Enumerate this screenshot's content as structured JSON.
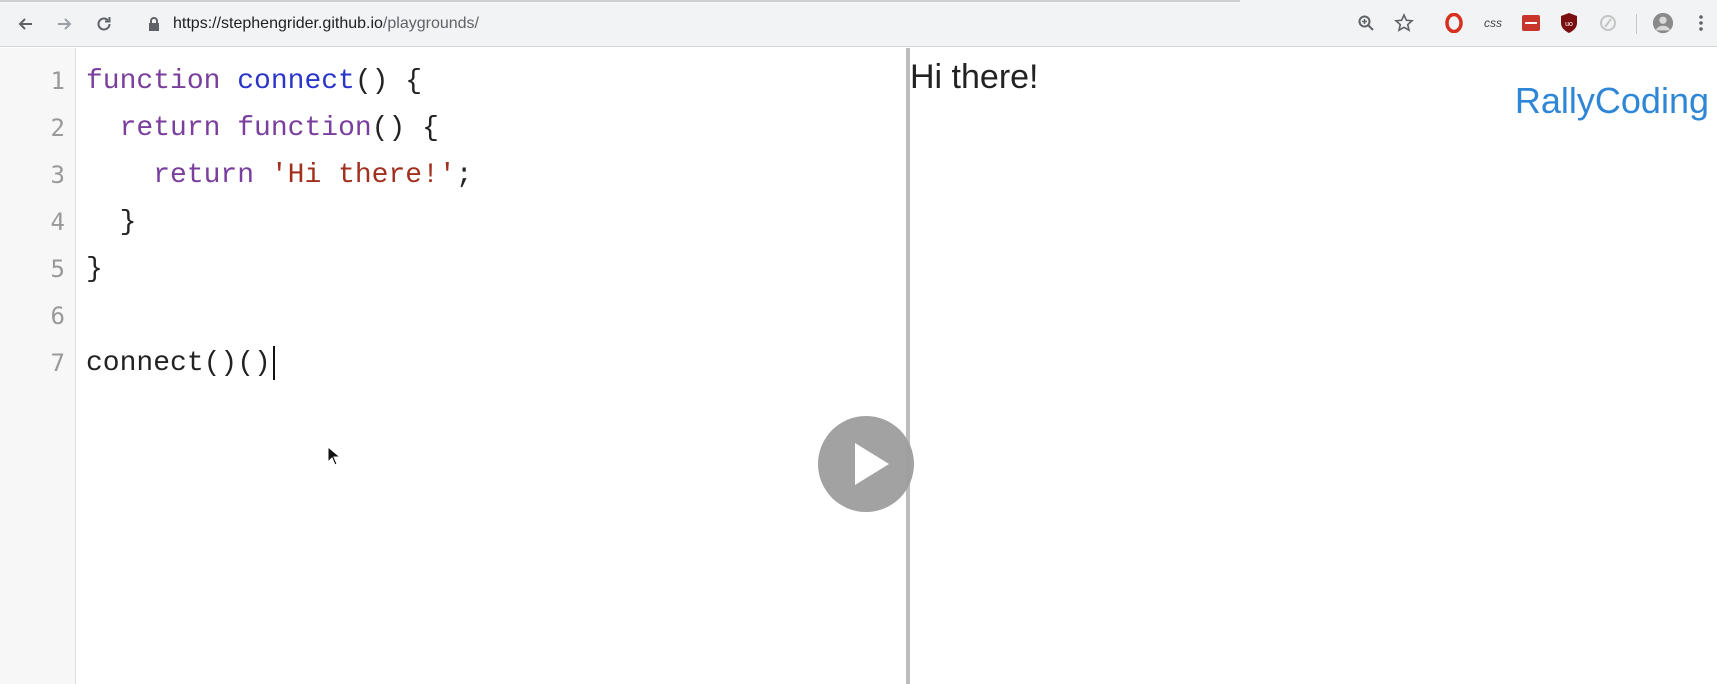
{
  "browser": {
    "url_main": "https://stephengrider.github.io",
    "url_path": "/playgrounds/",
    "toolbar_icons": [
      "back-icon",
      "forward-icon",
      "reload-icon",
      "lock-icon",
      "zoom-icon",
      "star-icon",
      "opera-icon",
      "css-icon",
      "extension-red-icon",
      "ublock-icon",
      "extension-gray-icon",
      "profile-avatar-icon",
      "menu-icon"
    ],
    "css_extension_label": "css"
  },
  "editor": {
    "line_numbers": [
      "1",
      "2",
      "3",
      "4",
      "5",
      "6",
      "7"
    ],
    "lines": [
      [
        {
          "t": "function",
          "c": "kw"
        },
        {
          "t": " "
        },
        {
          "t": "connect",
          "c": "fn"
        },
        {
          "t": "() {"
        }
      ],
      [
        {
          "t": "  "
        },
        {
          "t": "return",
          "c": "kw"
        },
        {
          "t": " "
        },
        {
          "t": "function",
          "c": "kw"
        },
        {
          "t": "() {"
        }
      ],
      [
        {
          "t": "    "
        },
        {
          "t": "return",
          "c": "kw"
        },
        {
          "t": " "
        },
        {
          "t": "'Hi there!'",
          "c": "str"
        },
        {
          "t": ";"
        }
      ],
      [
        {
          "t": "  }"
        }
      ],
      [
        {
          "t": "}"
        }
      ],
      [],
      [
        {
          "t": "connect()()"
        }
      ]
    ],
    "colors": {
      "keyword": "#7a3e9d",
      "function_name": "#2a35c9",
      "string": "#a1301f"
    }
  },
  "output": {
    "result_text": "Hi there!",
    "brand": "RallyCoding"
  },
  "overlay": {
    "play_icon": "play-icon"
  }
}
